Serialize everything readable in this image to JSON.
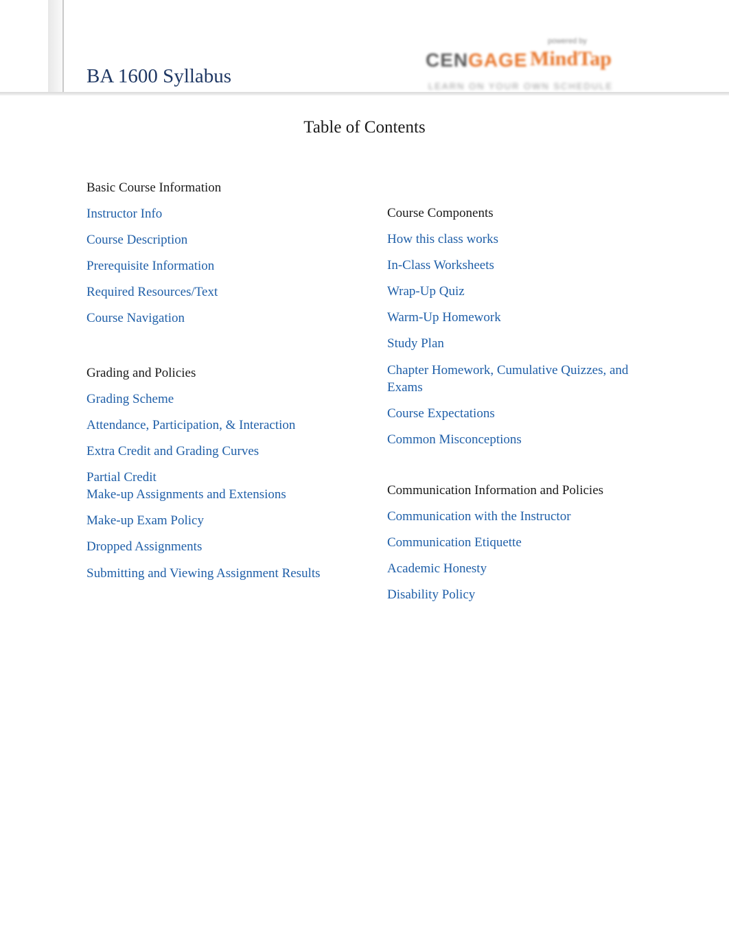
{
  "document": {
    "title": "BA 1600 Syllabus",
    "toc_heading": "Table of Contents"
  },
  "logo": {
    "mark_dark": "CEN",
    "mark_accent": "GAGE",
    "wordmark": "MindTap",
    "tagline": "powered by",
    "subline": "LEARN  ON  YOUR  OWN  SCHEDULE"
  },
  "toc": {
    "left_column": [
      {
        "type": "group",
        "label": "Basic Course Information"
      },
      {
        "type": "link",
        "label": "Instructor Info"
      },
      {
        "type": "link",
        "label": "Course Description"
      },
      {
        "type": "link",
        "label": "Prerequisite Information"
      },
      {
        "type": "link",
        "label": "Required Resources/Text"
      },
      {
        "type": "link",
        "label": "Course Navigation"
      },
      {
        "type": "group",
        "label": "Grading and Policies"
      },
      {
        "type": "link",
        "label": "Grading Scheme"
      },
      {
        "type": "link",
        "label": "Attendance, Participation, & Interaction"
      },
      {
        "type": "link",
        "label": "Extra Credit and Grading Curves"
      },
      {
        "type": "link",
        "label": "Partial Credit"
      },
      {
        "type": "link",
        "label": "Make-up Assignments and Extensions"
      },
      {
        "type": "link",
        "label": "Make-up Exam Policy"
      },
      {
        "type": "link",
        "label": "Dropped Assignments"
      },
      {
        "type": "link",
        "label": "Submitting and Viewing Assignment Results"
      }
    ],
    "right_column": [
      {
        "type": "group",
        "label": "Course Components"
      },
      {
        "type": "link",
        "label": "How this class works"
      },
      {
        "type": "link",
        "label": "In-Class Worksheets"
      },
      {
        "type": "link",
        "label": "Wrap-Up Quiz"
      },
      {
        "type": "link",
        "label": "Warm-Up Homework"
      },
      {
        "type": "link",
        "label": "Study Plan"
      },
      {
        "type": "link",
        "label": "Chapter Homework, Cumulative Quizzes, and Exams"
      },
      {
        "type": "link",
        "label": "Course Expectations"
      },
      {
        "type": "link",
        "label": "Common Misconceptions"
      },
      {
        "type": "group",
        "label": "Communication Information and Policies"
      },
      {
        "type": "link",
        "label": "Communication with the Instructor"
      },
      {
        "type": "link",
        "label": "Communication Etiquette"
      },
      {
        "type": "link",
        "label": "Academic Honesty"
      },
      {
        "type": "link",
        "label": "Disability Policy"
      }
    ]
  },
  "colors": {
    "title": "#1f3864",
    "link": "#1f5fa8",
    "text": "#1a1a1a",
    "logo_accent": "#e8762c"
  }
}
